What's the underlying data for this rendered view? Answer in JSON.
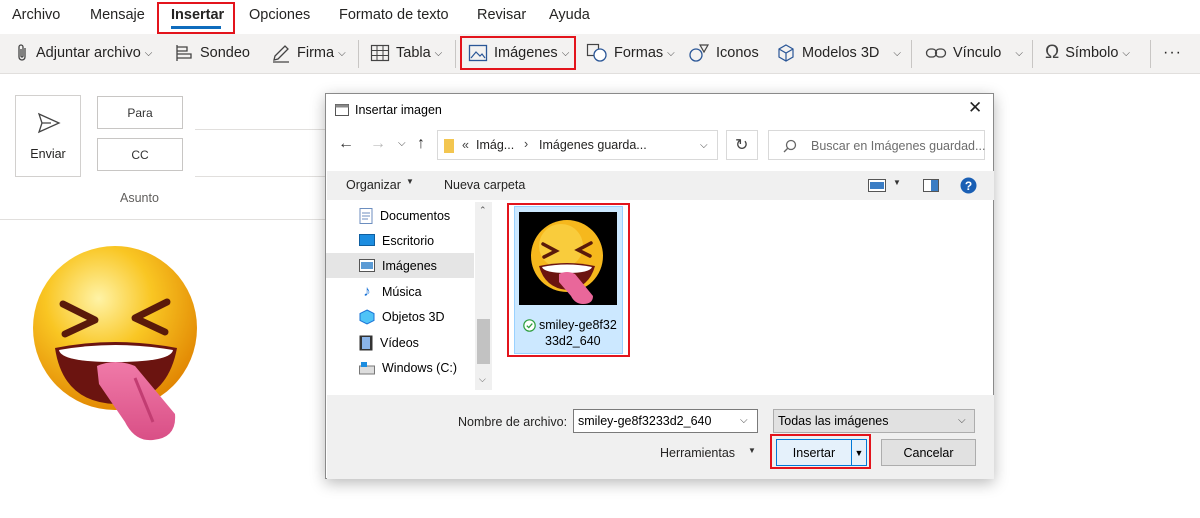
{
  "ribbon": {
    "tabs": [
      "Archivo",
      "Mensaje",
      "Insertar",
      "Opciones",
      "Formato de texto",
      "Revisar",
      "Ayuda"
    ],
    "active_tab": "Insertar"
  },
  "toolbar": {
    "attach": "Adjuntar archivo",
    "poll": "Sondeo",
    "signature": "Firma",
    "table": "Tabla",
    "images": "Imágenes",
    "shapes": "Formas",
    "icons": "Iconos",
    "models3d": "Modelos 3D",
    "link": "Vínculo",
    "symbol": "Símbolo",
    "more": "···"
  },
  "compose": {
    "send": "Enviar",
    "to": "Para",
    "cc": "CC",
    "subject": "Asunto"
  },
  "dialog": {
    "title": "Insertar imagen",
    "breadcrumb_prefix": "«",
    "breadcrumb": [
      "Imág...",
      "Imágenes guarda..."
    ],
    "search_placeholder": "Buscar en Imágenes guardad...",
    "organize": "Organizar",
    "new_folder": "Nueva carpeta",
    "nav_items": [
      "Documentos",
      "Escritorio",
      "Imágenes",
      "Música",
      "Objetos 3D",
      "Vídeos",
      "Windows (C:)"
    ],
    "selected_nav": "Imágenes",
    "file": {
      "name_line1": "smiley-ge8f32",
      "name_line2": "33d2_640"
    },
    "filename_label": "Nombre de archivo:",
    "filename_value": "smiley-ge8f3233d2_640",
    "filetype": "Todas las imágenes",
    "tools": "Herramientas",
    "insert": "Insertar",
    "cancel": "Cancelar"
  },
  "colors": {
    "accent": "#0f6cbd",
    "highlight_red": "#e3141c",
    "selection_blue": "#cce8ff"
  }
}
